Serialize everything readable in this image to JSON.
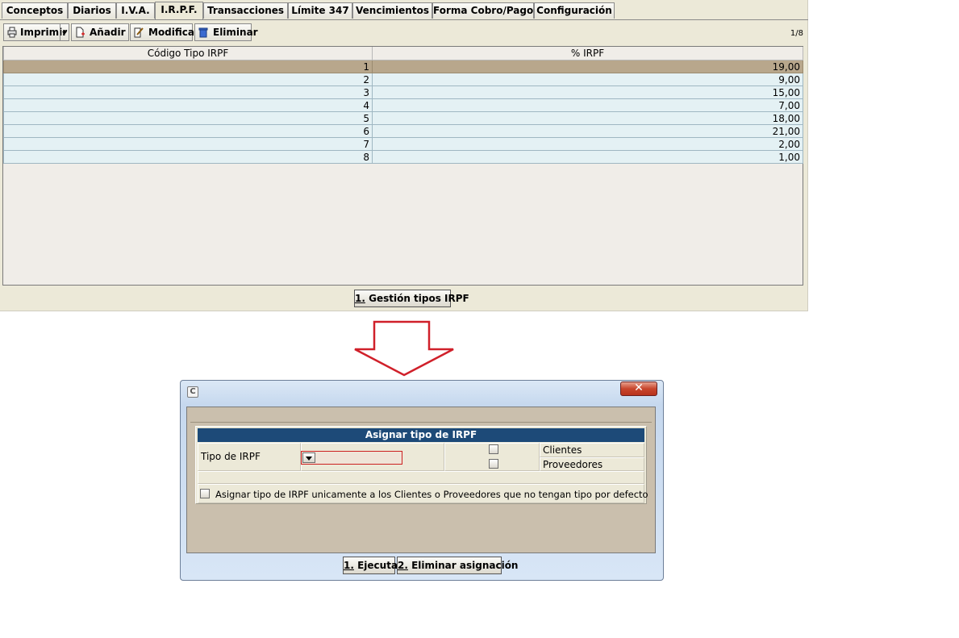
{
  "tabs": [
    "Conceptos",
    "Diarios",
    "I.V.A.",
    "I.R.P.F.",
    "Transacciones",
    "Límite 347",
    "Vencimientos",
    "Forma Cobro/Pago",
    "Configuración"
  ],
  "active_tab": "I.R.P.F.",
  "toolbar": {
    "print_label": "Imprimir",
    "add_label": "Añadir",
    "edit_label": "Modificar",
    "delete_label": "Eliminar",
    "pager": "1/8"
  },
  "grid": {
    "headers": [
      "Código Tipo IRPF",
      "% IRPF"
    ],
    "rows": [
      [
        "1",
        "19,00"
      ],
      [
        "2",
        "9,00"
      ],
      [
        "3",
        "15,00"
      ],
      [
        "4",
        "7,00"
      ],
      [
        "5",
        "18,00"
      ],
      [
        "6",
        "21,00"
      ],
      [
        "7",
        "2,00"
      ],
      [
        "8",
        "1,00"
      ]
    ],
    "selected_row": 1
  },
  "panel_footer": {
    "button_number": "1.",
    "button_label": " Gestión tipos IRPF"
  },
  "dialog": {
    "app_icon": "C",
    "section_title": "Asignar tipo de IRPF",
    "tipo_label": "Tipo de IRPF",
    "tipo_value": "",
    "clientes_label": "Clientes",
    "proveedores_label": "Proveedores",
    "only_default_label": "Asignar tipo de IRPF unicamente a los Clientes o Proveedores que no tengan tipo por defecto",
    "execute_number": "1.",
    "execute_label": " Ejecutar",
    "remove_number": "2.",
    "remove_label": " Eliminar asignación"
  },
  "colors": {
    "selected_row": "#b8a78c",
    "row": "#e4f1f4",
    "dialog_header": "#1d4a78",
    "arrow": "#d0202a"
  }
}
